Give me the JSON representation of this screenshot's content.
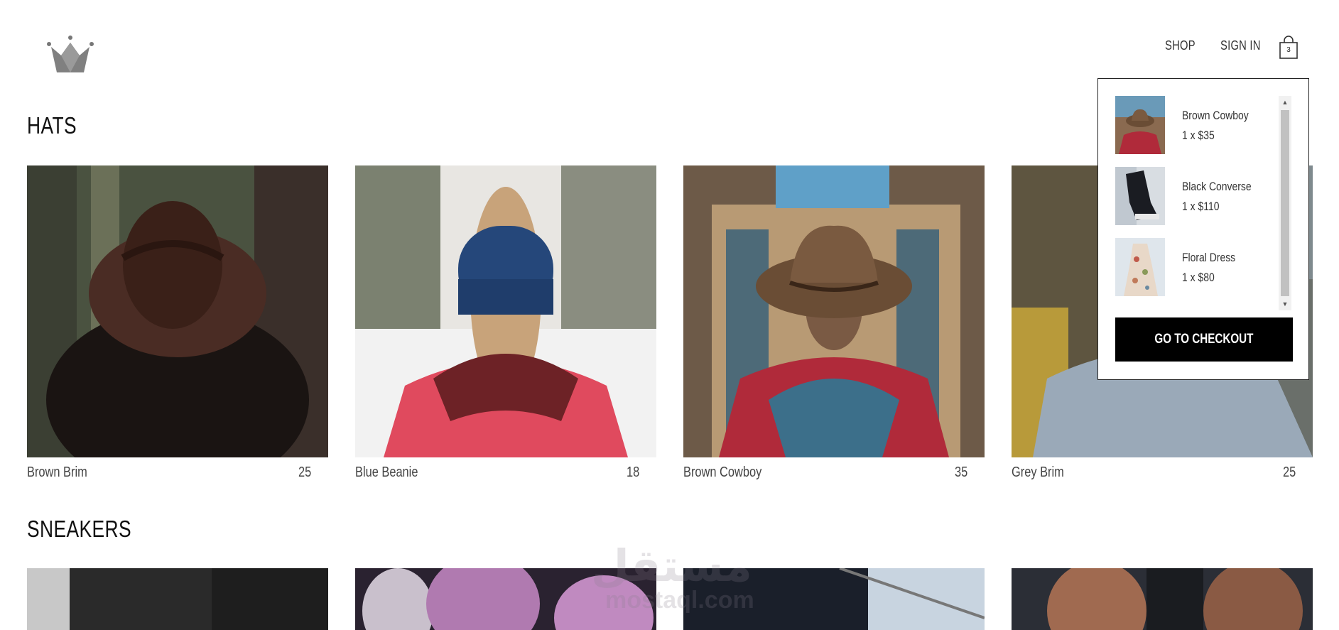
{
  "header": {
    "nav": {
      "shop": "SHOP",
      "sign_in": "SIGN IN"
    },
    "cart_count": "3"
  },
  "sections": [
    {
      "title": "HATS",
      "items": [
        {
          "name": "Brown Brim",
          "price": "25"
        },
        {
          "name": "Blue Beanie",
          "price": "18"
        },
        {
          "name": "Brown Cowboy",
          "price": "35"
        },
        {
          "name": "Grey Brim",
          "price": "25"
        }
      ]
    },
    {
      "title": "SNEAKERS"
    }
  ],
  "cart_dropdown": {
    "items": [
      {
        "name": "Brown Cowboy",
        "qty_price": "1 x $35"
      },
      {
        "name": "Black Converse",
        "qty_price": "1 x $110"
      },
      {
        "name": "Floral Dress",
        "qty_price": "1 x $80"
      }
    ],
    "checkout_label": "GO TO CHECKOUT"
  },
  "watermark": {
    "arabic": "مستقل",
    "latin": "mostaql.com"
  }
}
